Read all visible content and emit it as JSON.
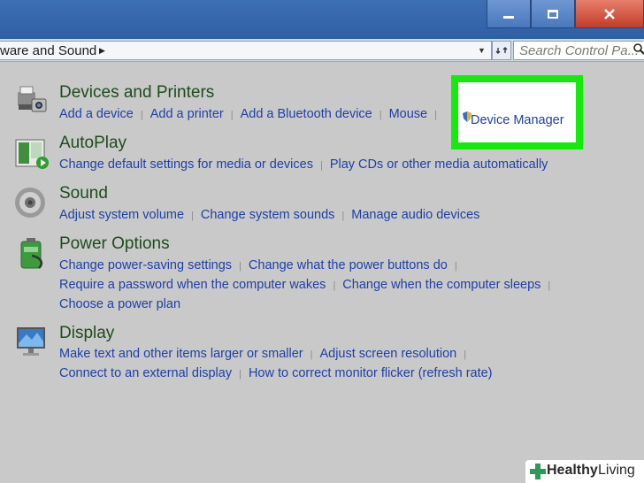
{
  "window": {
    "minimize_icon": "minimize-icon",
    "maximize_icon": "maximize-icon",
    "close_icon": "close-icon"
  },
  "address": {
    "breadcrumb": "ware and Sound",
    "search_placeholder": "Search Control Pa..."
  },
  "categories": [
    {
      "title": "Devices and Printers",
      "icon": "printer-camera-icon",
      "links": [
        "Add a device",
        "Add a printer",
        "Add a Bluetooth device",
        "Mouse"
      ]
    },
    {
      "title": "AutoPlay",
      "icon": "autoplay-icon",
      "links": [
        "Change default settings for media or devices",
        "Play CDs or other media automatically"
      ]
    },
    {
      "title": "Sound",
      "icon": "speaker-icon",
      "links": [
        "Adjust system volume",
        "Change system sounds",
        "Manage audio devices"
      ]
    },
    {
      "title": "Power Options",
      "icon": "battery-icon",
      "links": [
        "Change power-saving settings",
        "Change what the power buttons do",
        "Require a password when the computer wakes",
        "Change when the computer sleeps",
        "Choose a power plan"
      ]
    },
    {
      "title": "Display",
      "icon": "monitor-icon",
      "links": [
        "Make text and other items larger or smaller",
        "Adjust screen resolution",
        "Connect to an external display",
        "How to correct monitor flicker (refresh rate)"
      ]
    }
  ],
  "device_manager": {
    "label": "Device Manager",
    "icon": "shield-icon",
    "highlight_color": "#16e90c"
  },
  "watermark": {
    "part1": "Healthy",
    "part2": "Living"
  },
  "colors": {
    "link": "#1f3fa6",
    "title": "#1e4b1e",
    "background": "#c9c9c9"
  }
}
